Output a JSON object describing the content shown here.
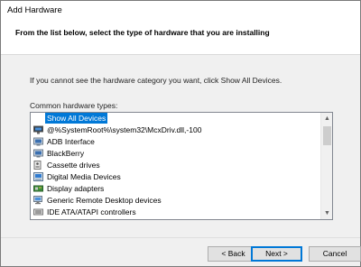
{
  "window": {
    "title": "Add Hardware"
  },
  "header": {
    "heading": "From the list below, select the type of hardware that you are installing"
  },
  "info_text": "If you cannot see the hardware category you want, click Show All Devices.",
  "list": {
    "label": "Common hardware types:",
    "items": [
      {
        "label": "Show All Devices",
        "icon": "none",
        "selected": true
      },
      {
        "label": "@%SystemRoot%\\system32\\McxDriv.dll,-100",
        "icon": "media-center-extender-icon"
      },
      {
        "label": "ADB Interface",
        "icon": "adb-device-icon"
      },
      {
        "label": "BlackBerry",
        "icon": "blackberry-device-icon"
      },
      {
        "label": "Cassette drives",
        "icon": "cassette-drive-icon"
      },
      {
        "label": "Digital Media Devices",
        "icon": "digital-media-device-icon"
      },
      {
        "label": "Display adapters",
        "icon": "display-adapter-icon"
      },
      {
        "label": "Generic Remote Desktop devices",
        "icon": "remote-desktop-device-icon"
      },
      {
        "label": "IDE ATA/ATAPI controllers",
        "icon": "ide-controller-icon"
      }
    ]
  },
  "buttons": {
    "back": "< Back",
    "next": "Next >",
    "cancel": "Cancel"
  },
  "colors": {
    "selection": "#0078d7",
    "accent_border": "#0078d7"
  }
}
